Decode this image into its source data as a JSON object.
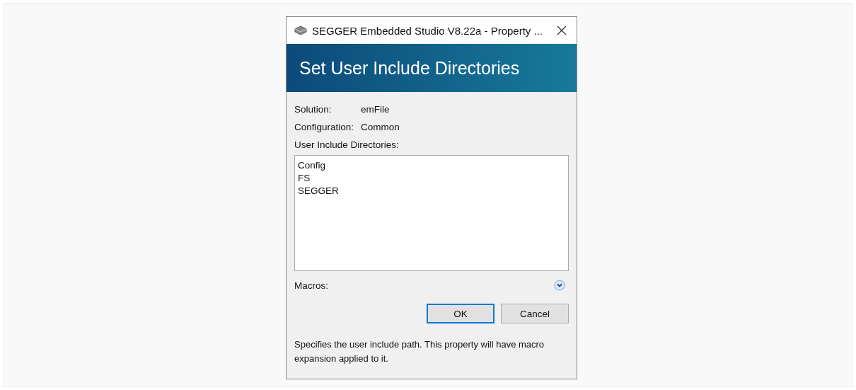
{
  "window": {
    "title": "SEGGER Embedded Studio V8.22a - Property ..."
  },
  "header": {
    "title": "Set User Include Directories"
  },
  "info": [
    {
      "label": "Solution:",
      "value": "emFile"
    },
    {
      "label": "Configuration:",
      "value": "Common"
    }
  ],
  "directories": {
    "label": "User Include Directories:",
    "lines": [
      "Config",
      "FS",
      "SEGGER"
    ]
  },
  "macros": {
    "label": "Macros:",
    "expanded": false
  },
  "buttons": [
    {
      "label": "OK",
      "default": true
    },
    {
      "label": "Cancel",
      "default": false
    }
  ],
  "description": "Specifies the user include path. This property will have macro expansion applied to it."
}
